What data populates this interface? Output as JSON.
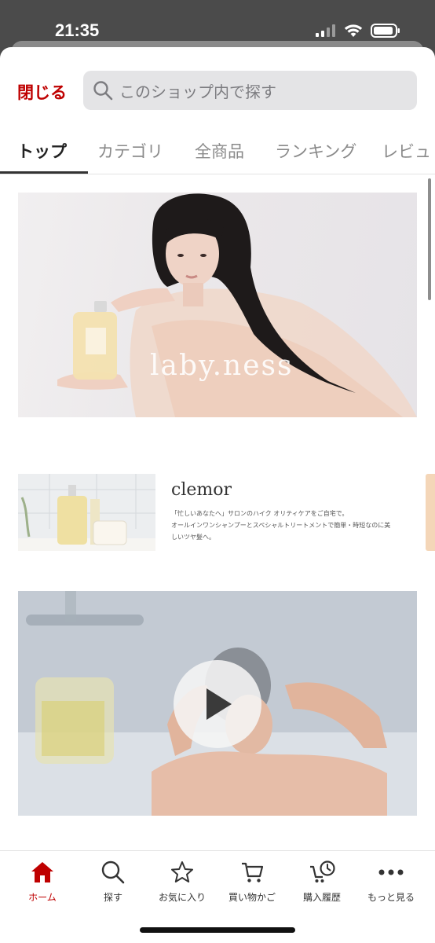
{
  "status_bar": {
    "time": "21:35"
  },
  "header": {
    "close_label": "閉じる",
    "search_placeholder": "このショップ内で探す"
  },
  "tabs": [
    {
      "label": "トップ",
      "active": true
    },
    {
      "label": "カテゴリ",
      "active": false
    },
    {
      "label": "全商品",
      "active": false
    },
    {
      "label": "ランキング",
      "active": false
    },
    {
      "label": "レビュ",
      "active": false
    }
  ],
  "hero": {
    "logo_text": "laby.ness"
  },
  "clemor": {
    "title": "clemor",
    "description_line1": "「忙しいあなたへ」サロンのハイク オリティケアをご自宅で。",
    "description_line2": "オールインワンシャンプーとスペシャルトリートメントで簡単・時短なのに美",
    "description_line3": "しいツヤ髪へ。"
  },
  "bottom_nav": [
    {
      "label": "ホーム",
      "icon": "home-icon",
      "active": true
    },
    {
      "label": "探す",
      "icon": "search-icon",
      "active": false
    },
    {
      "label": "お気に入り",
      "icon": "star-icon",
      "active": false
    },
    {
      "label": "買い物かご",
      "icon": "cart-icon",
      "active": false
    },
    {
      "label": "購入履歴",
      "icon": "history-cart-icon",
      "active": false
    },
    {
      "label": "もっと見る",
      "icon": "more-icon",
      "active": false
    }
  ],
  "colors": {
    "accent": "#bf0000",
    "search_bg": "#e4e4e6",
    "tab_active": "#222222",
    "tab_inactive": "#8a8a8a"
  }
}
